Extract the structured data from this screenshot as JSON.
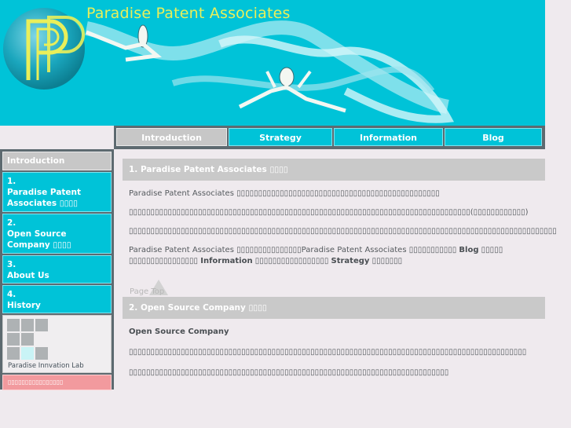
{
  "header": {
    "title": "Paradise Patent Associates"
  },
  "topnav": {
    "tabs": [
      {
        "label": "Introduction",
        "active": true
      },
      {
        "label": "Strategy",
        "active": false
      },
      {
        "label": "Information",
        "active": false
      },
      {
        "label": "Blog",
        "active": false
      }
    ]
  },
  "sidebar": {
    "header": "Introduction",
    "items": [
      {
        "num": "1.",
        "label": "Paradise Patent Associates ▯▯▯▯"
      },
      {
        "num": "2.",
        "label": "Open Source Company ▯▯▯▯"
      },
      {
        "num": "3.",
        "label": "About Us"
      },
      {
        "num": "4.",
        "label": "History"
      }
    ],
    "lab_label": "Paradise Innvation Lab",
    "red_button": "▯▯▯▯▯▯▯▯▯▯▯▯▯▯▯▯"
  },
  "sections": {
    "s1": {
      "heading": "1. Paradise Patent Associates ▯▯▯▯",
      "p1": "Paradise Patent Associates ▯▯▯▯▯▯▯▯▯▯▯▯▯▯▯▯▯▯▯▯▯▯▯▯▯▯▯▯▯▯▯▯▯▯▯▯▯▯▯▯▯▯▯▯▯▯▯",
      "p2": "▯▯▯▯▯▯▯▯▯▯▯▯▯▯▯▯▯▯▯▯▯▯▯▯▯▯▯▯▯▯▯▯▯▯▯▯▯▯▯▯▯▯▯▯▯▯▯▯▯▯▯▯▯▯▯▯▯▯▯▯▯▯▯▯▯▯▯▯▯▯▯▯▯▯▯▯▯▯▯(▯▯▯▯▯▯▯▯▯▯▯▯)",
      "p3": "▯▯▯▯▯▯▯▯▯▯▯▯▯▯▯▯▯▯▯▯▯▯▯▯▯▯▯▯▯▯▯▯▯▯▯▯▯▯▯▯▯▯▯▯▯▯▯▯▯▯▯▯▯▯▯▯▯▯▯▯▯▯▯▯▯▯▯▯▯▯▯▯▯▯▯▯▯▯▯▯▯▯▯▯▯▯▯▯▯▯▯▯▯▯▯▯▯▯▯",
      "p4_a": "Paradise Patent Associates ▯▯▯▯▯▯▯▯▯▯▯▯▯▯▯Paradise Patent Associates ▯▯▯▯▯▯▯▯▯▯▯ ",
      "p4_blog": "Blog",
      "p4_b": " ▯▯▯▯▯ ▯▯▯▯▯▯▯▯▯▯▯▯▯▯▯▯ ",
      "p4_info": "Information",
      "p4_c": " ▯▯▯▯▯▯▯▯▯▯▯▯▯▯▯▯▯ ",
      "p4_strategy": "Strategy",
      "p4_d": " ▯▯▯▯▯▯▯"
    },
    "pagetop": "Page Top",
    "s2": {
      "heading": "2. Open Source Company ▯▯▯▯",
      "subtitle": "Open Source Company",
      "p1": "▯▯▯▯▯▯▯▯▯▯▯▯▯▯▯▯▯▯▯▯▯▯▯▯▯▯▯▯▯▯▯▯▯▯▯▯▯▯▯▯▯▯▯▯▯▯▯▯▯▯▯▯▯▯▯▯▯▯▯▯▯▯▯▯▯▯▯▯▯▯▯▯▯▯▯▯▯▯▯▯▯▯▯▯▯▯▯▯▯▯▯▯",
      "p2": "▯▯▯▯▯▯▯▯▯▯▯▯▯▯▯▯▯▯▯▯▯▯▯▯▯▯▯▯▯▯▯▯▯▯▯▯▯▯▯▯▯▯▯▯▯▯▯▯▯▯▯▯▯▯▯▯▯▯▯▯▯▯▯▯▯▯▯▯▯▯▯▯▯▯"
    }
  },
  "colors": {
    "banner": "#00c3d8",
    "title": "#e9ef5a",
    "nav_frame": "#5d6a70",
    "section_head": "#c9c9c9",
    "red_button": "#f29a9e"
  }
}
